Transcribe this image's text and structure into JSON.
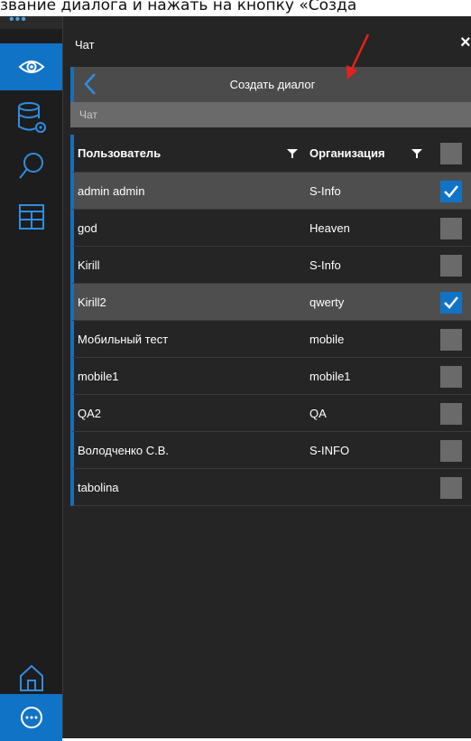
{
  "instruction_text": "звание диалога и нажать на кнопку «Созда",
  "sidebar": {
    "items": [
      {
        "name": "eye-icon",
        "active": true
      },
      {
        "name": "database-settings-icon",
        "active": false
      },
      {
        "name": "search-icon",
        "active": false
      },
      {
        "name": "layout-icon",
        "active": false
      },
      {
        "name": "home-icon",
        "active": false
      },
      {
        "name": "more-icon",
        "active": false
      }
    ]
  },
  "panel": {
    "title": "Чат",
    "close_label": "×",
    "dialog_title": "Создать диалог",
    "search_placeholder": "Чат"
  },
  "table": {
    "col_user": "Пользователь",
    "col_org": "Организация",
    "rows": [
      {
        "user": "admin admin",
        "org": "S-Info",
        "checked": true
      },
      {
        "user": "god",
        "org": "Heaven",
        "checked": false
      },
      {
        "user": "Kirill",
        "org": "S-Info",
        "checked": false
      },
      {
        "user": "Kirill2",
        "org": "qwerty",
        "checked": true
      },
      {
        "user": "Мобильный тест",
        "org": "mobile",
        "checked": false
      },
      {
        "user": "mobile1",
        "org": "mobile1",
        "checked": false
      },
      {
        "user": "QA2",
        "org": "QA",
        "checked": false
      },
      {
        "user": "Володченко С.В.",
        "org": "S-INFO",
        "checked": false
      },
      {
        "user": "tabolina",
        "org": "",
        "checked": false
      }
    ]
  },
  "colors": {
    "accent": "#1173c6",
    "annotation": "#e8201c"
  }
}
